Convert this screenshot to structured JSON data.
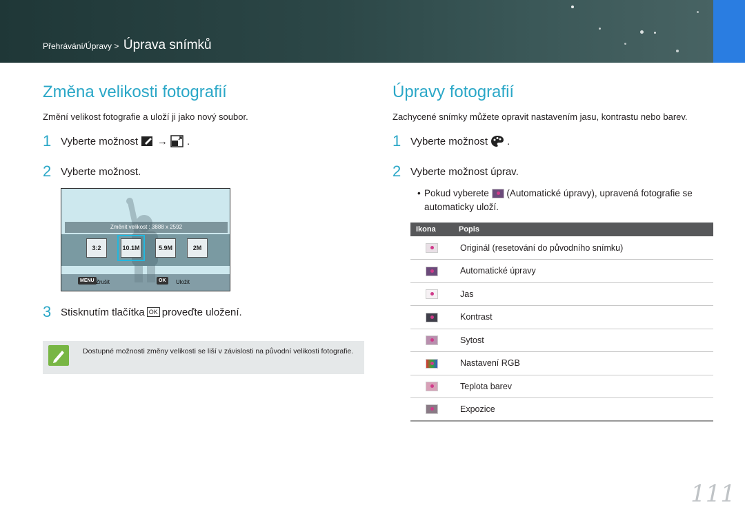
{
  "header": {
    "breadcrumb": "Přehrávání/Úpravy >",
    "current_section": "Úprava snímků"
  },
  "left": {
    "title": "Změna velikosti fotografií",
    "intro": "Změní velikost fotografie a uloží ji jako nový soubor.",
    "step1": {
      "num": "1",
      "text": "Vyberte možnost",
      "arrow": "→",
      "end": "."
    },
    "step2": {
      "num": "2",
      "text": "Vyberte možnost."
    },
    "screen": {
      "label": "Změnit velikost : 3888 x 2592",
      "options": [
        "3:2",
        "10.1M",
        "5.9M",
        "2M"
      ],
      "menu_key": "MENU",
      "menu_label": "Zrušit",
      "ok_key": "OK",
      "ok_label": "Uložit"
    },
    "step3": {
      "num": "3",
      "before": "Stisknutím tlačítka",
      "ok_top": "OK",
      "after": "proveďte uložení."
    },
    "note": "Dostupné možnosti změny velikosti se liší v závislosti na původní velikosti fotografie."
  },
  "right": {
    "title": "Úpravy fotografií",
    "intro": "Zachycené snímky můžete opravit nastavením jasu, kontrastu nebo barev.",
    "step1": {
      "num": "1",
      "text": "Vyberte možnost",
      "end": "."
    },
    "step2": {
      "num": "2",
      "text": "Vyberte možnost úprav."
    },
    "bullet_before": "Pokud vyberete",
    "bullet_after": "(Automatické úpravy), upravená fotografie se automaticky uloží.",
    "table": {
      "headers": [
        "Ikona",
        "Popis"
      ],
      "rows": [
        "Originál (resetování do původního snímku)",
        "Automatické úpravy",
        "Jas",
        "Kontrast",
        "Sytost",
        "Nastavení RGB",
        "Teplota barev",
        "Expozice"
      ]
    }
  },
  "page_number": "111",
  "colors": {
    "accent": "#2aa7c7",
    "header": "#2c4747",
    "blue_tab": "#2a7de1",
    "note_icon": "#78b644"
  }
}
